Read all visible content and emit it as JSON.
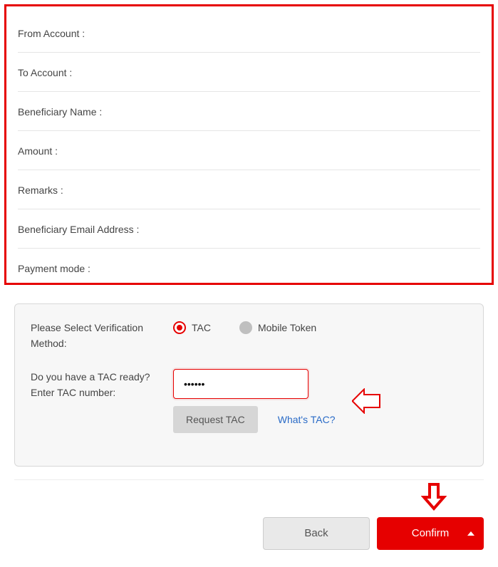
{
  "details": {
    "from_account": "From Account :",
    "to_account": "To Account :",
    "beneficiary_name": "Beneficiary Name :",
    "amount": "Amount :",
    "remarks": "Remarks :",
    "beneficiary_email": "Beneficiary Email Address :",
    "payment_mode": "Payment mode :"
  },
  "verify": {
    "method_label": "Please Select Verification Method:",
    "tac_label": "TAC",
    "mobile_token_label": "Mobile Token",
    "tac_prompt": "Do you have a TAC ready? Enter TAC number:",
    "tac_value": "••••••",
    "request_tac_label": "Request TAC",
    "whats_tac_label": "What's TAC?"
  },
  "footer": {
    "back_label": "Back",
    "confirm_label": "Confirm"
  }
}
